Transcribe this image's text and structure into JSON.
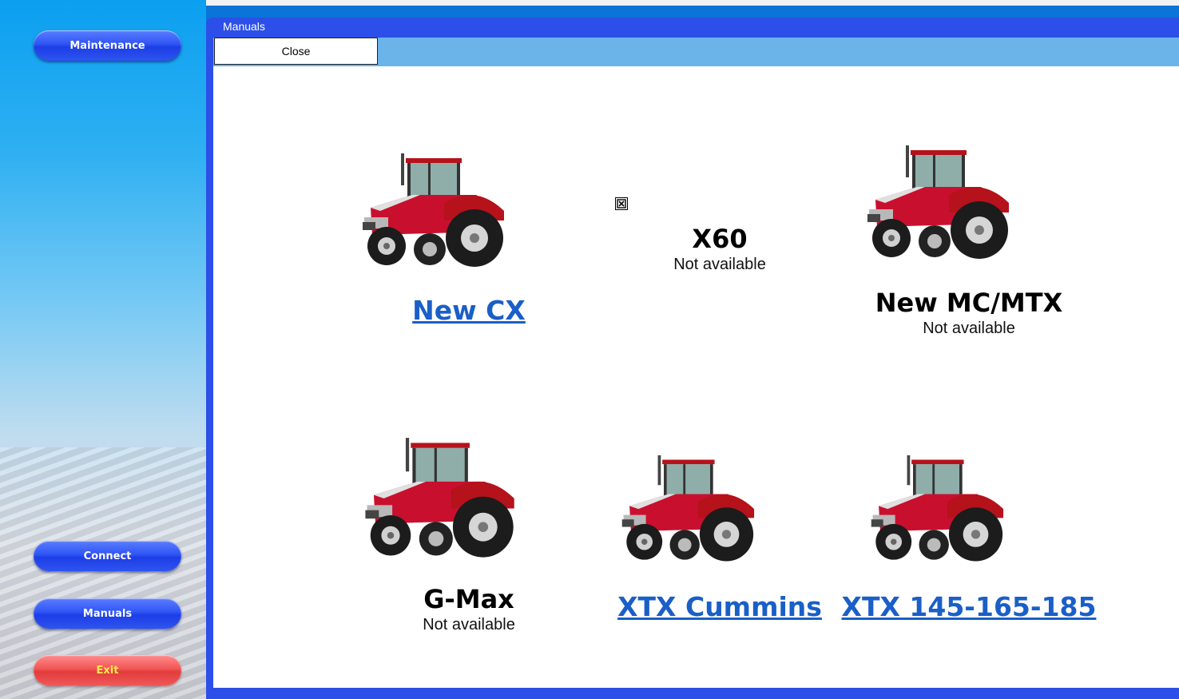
{
  "sidebar": {
    "maintenance_label": "Maintenance",
    "connect_label": "Connect",
    "manuals_label": "Manuals",
    "exit_label": "Exit"
  },
  "window": {
    "title": "Manuals",
    "close_label": "Close"
  },
  "models": [
    {
      "name": "New CX",
      "status": ""
    },
    {
      "name": "X60",
      "status": "Not available"
    },
    {
      "name": "New MC/MTX",
      "status": "Not available"
    },
    {
      "name": "G-Max",
      "status": "Not available"
    },
    {
      "name": "XTX Cummins",
      "status": ""
    },
    {
      "name": "XTX 145-165-185",
      "status": ""
    }
  ],
  "icons": {
    "tractor": "tractor-image",
    "broken": "broken-image-icon"
  },
  "colors": {
    "link": "#1a5fc8",
    "window_frame": "#2b4fe8",
    "toolbar": "#6ab4ea",
    "tractor_body": "#c8102e",
    "exit_text": "#ffe94a"
  }
}
